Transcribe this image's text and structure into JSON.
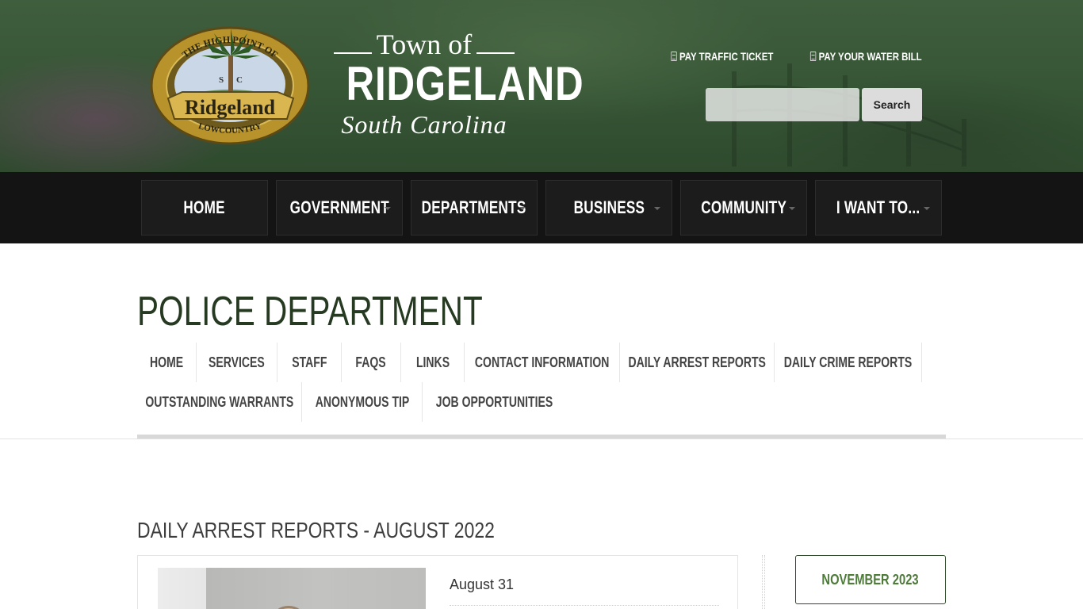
{
  "header": {
    "seal": {
      "top_text": "THE HIGH POINT OF",
      "banner_text": "Ridgeland",
      "bottom_text": "LOWCOUNTRY",
      "state_abbr_left": "S",
      "state_abbr_right": "C"
    },
    "wordmark": {
      "town_of": "Town of",
      "name": "RIDGELAND",
      "state": "South Carolina"
    },
    "quick_links": [
      {
        "label": "PAY TRAFFIC TICKET",
        "icon": "document-icon"
      },
      {
        "label": "PAY YOUR WATER BILL",
        "icon": "document-icon"
      }
    ],
    "search": {
      "placeholder": "",
      "value": "",
      "button_label": "Search"
    }
  },
  "main_nav": {
    "items": [
      {
        "label": "HOME",
        "has_dropdown": false
      },
      {
        "label": "GOVERNMENT",
        "has_dropdown": true
      },
      {
        "label": "DEPARTMENTS",
        "has_dropdown": true
      },
      {
        "label": "BUSINESS",
        "has_dropdown": true
      },
      {
        "label": "COMMUNITY",
        "has_dropdown": true
      },
      {
        "label": "I WANT TO...",
        "has_dropdown": true
      }
    ]
  },
  "page": {
    "title": "POLICE DEPARTMENT"
  },
  "sub_nav": {
    "items": [
      "HOME",
      "SERVICES",
      "STAFF",
      "FAQS",
      "LINKS",
      "CONTACT INFORMATION",
      "DAILY ARREST REPORTS",
      "DAILY CRIME REPORTS",
      "OUTSTANDING WARRANTS",
      "ANONYMOUS TIP",
      "JOB OPPORTUNITIES"
    ]
  },
  "content": {
    "heading": "DAILY ARREST REPORTS - AUGUST 2022",
    "reports": [
      {
        "title": "August 31"
      }
    ]
  },
  "sidebar": {
    "archive_button": "NOVEMBER 2023"
  },
  "colors": {
    "header_green": "#3f5e3d",
    "nav_black": "#141414",
    "title_green": "#263a22",
    "accent_green": "#4e7a3a"
  }
}
